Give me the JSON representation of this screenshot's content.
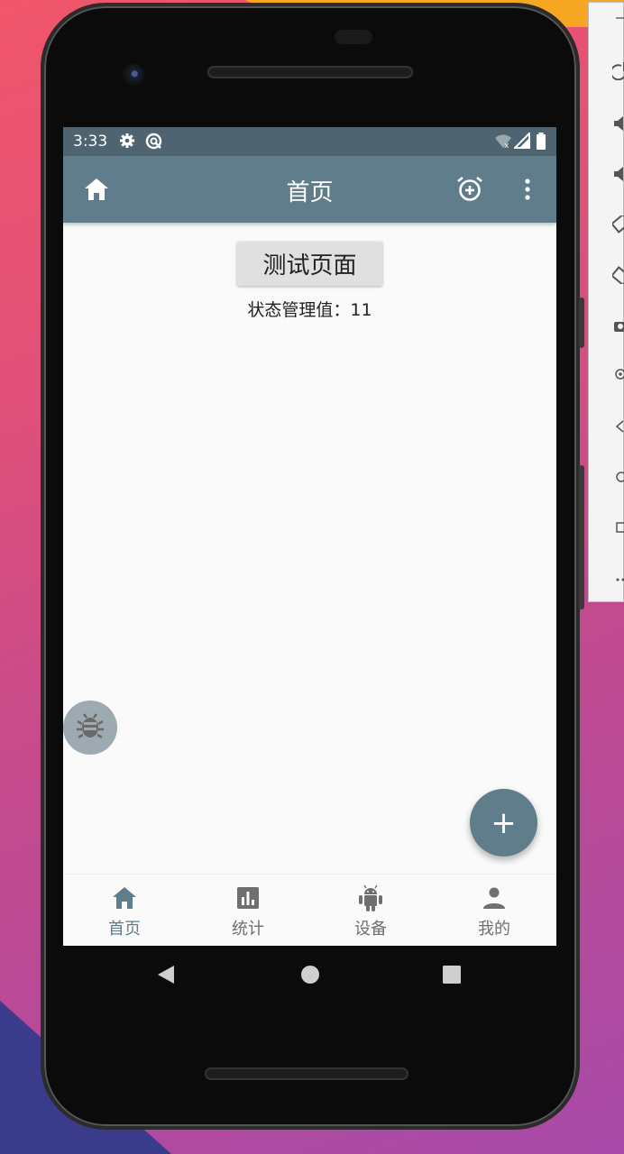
{
  "status_bar": {
    "time": "3:33",
    "icons": [
      "gear-icon",
      "sync-icon",
      "wifi-icon",
      "signal-icon",
      "battery-icon"
    ]
  },
  "app_bar": {
    "title": "首页",
    "left_icon": "home-icon",
    "right_icons": [
      "alarm-add-icon",
      "more-vert-icon"
    ]
  },
  "main": {
    "test_button_label": "测试页面",
    "state_text": "状态管理值：11"
  },
  "fab": {
    "symbol": "+"
  },
  "bottom_nav": {
    "items": [
      {
        "label": "首页",
        "icon": "home-icon",
        "active": true
      },
      {
        "label": "统计",
        "icon": "bar-chart-icon",
        "active": false
      },
      {
        "label": "设备",
        "icon": "android-icon",
        "active": false
      },
      {
        "label": "我的",
        "icon": "person-icon",
        "active": false
      }
    ]
  },
  "colors": {
    "primary": "#607d8b",
    "status_bar": "#4e6470",
    "background": "#fafafa",
    "inactive": "#6f6f6f"
  }
}
